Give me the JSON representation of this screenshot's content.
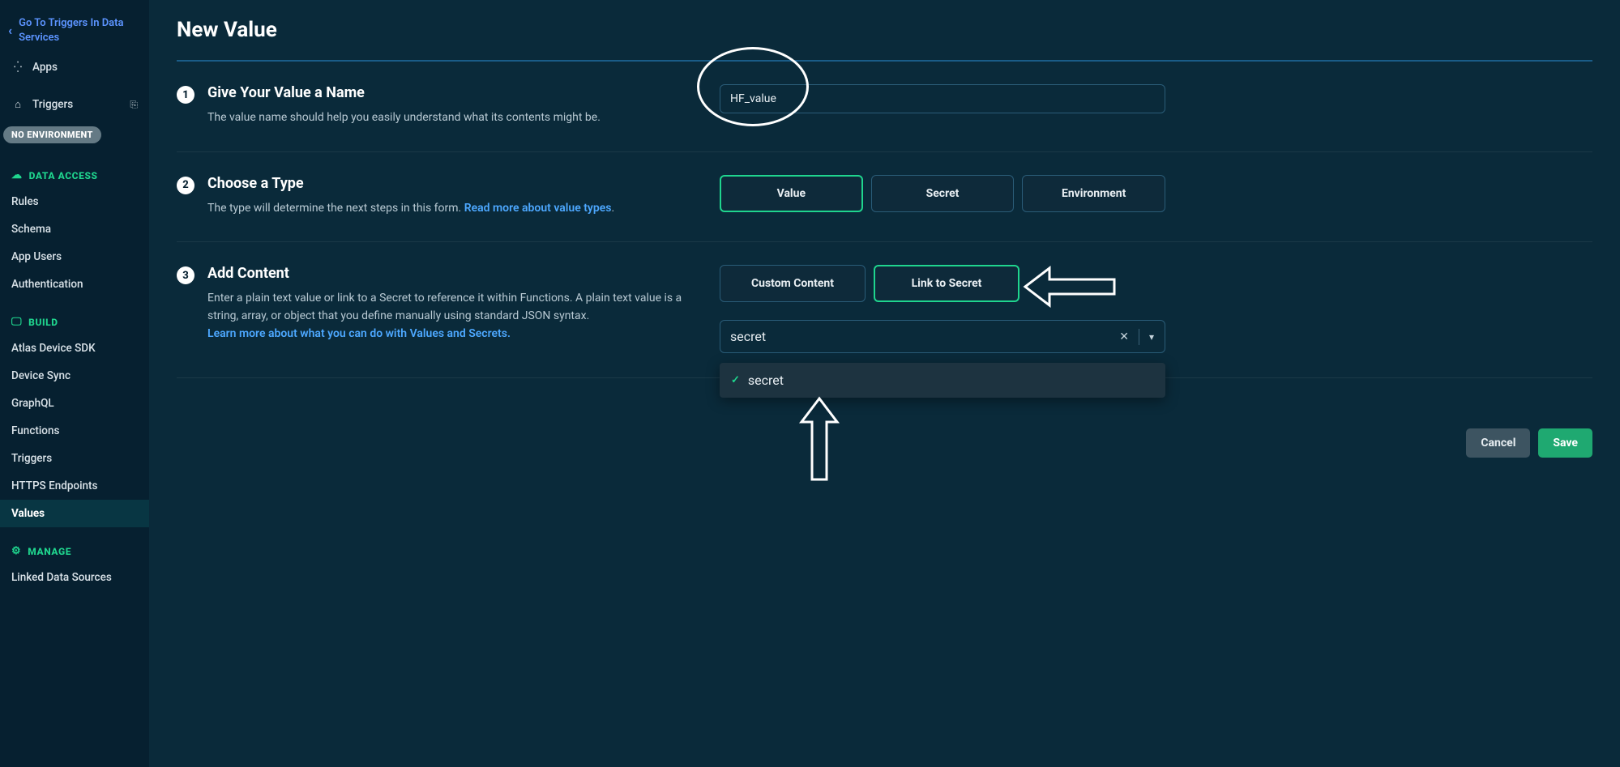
{
  "sidebar": {
    "back_label": "Go To Triggers In Data Services",
    "apps_label": "Apps",
    "triggers_label": "Triggers",
    "env_badge": "NO ENVIRONMENT",
    "sections": {
      "data_access": {
        "header": "DATA ACCESS",
        "items": [
          "Rules",
          "Schema",
          "App Users",
          "Authentication"
        ]
      },
      "build": {
        "header": "BUILD",
        "items": [
          "Atlas Device SDK",
          "Device Sync",
          "GraphQL",
          "Functions",
          "Triggers",
          "HTTPS Endpoints",
          "Values"
        ]
      },
      "manage": {
        "header": "MANAGE",
        "items": [
          "Linked Data Sources"
        ]
      }
    }
  },
  "main": {
    "page_title": "New Value",
    "step1": {
      "title": "Give Your Value a Name",
      "desc": "The value name should help you easily understand what its contents might be.",
      "input_value": "HF_value"
    },
    "step2": {
      "title": "Choose a Type",
      "desc_pre": "The type will determine the next steps in this form. ",
      "link": "Read more about value types",
      "desc_post": ".",
      "options": [
        "Value",
        "Secret",
        "Environment"
      ],
      "selected": "Value"
    },
    "step3": {
      "title": "Add Content",
      "desc": "Enter a plain text value or link to a Secret to reference it within Functions. A plain text value is a string, array, or object that you define manually using standard JSON syntax.",
      "link": "Learn more about what you can do with Values and Secrets.",
      "content_options": [
        "Custom Content",
        "Link to Secret"
      ],
      "content_selected": "Link to Secret",
      "select_value": "secret",
      "dropdown_item": "secret"
    },
    "footer": {
      "cancel": "Cancel",
      "save": "Save"
    }
  }
}
